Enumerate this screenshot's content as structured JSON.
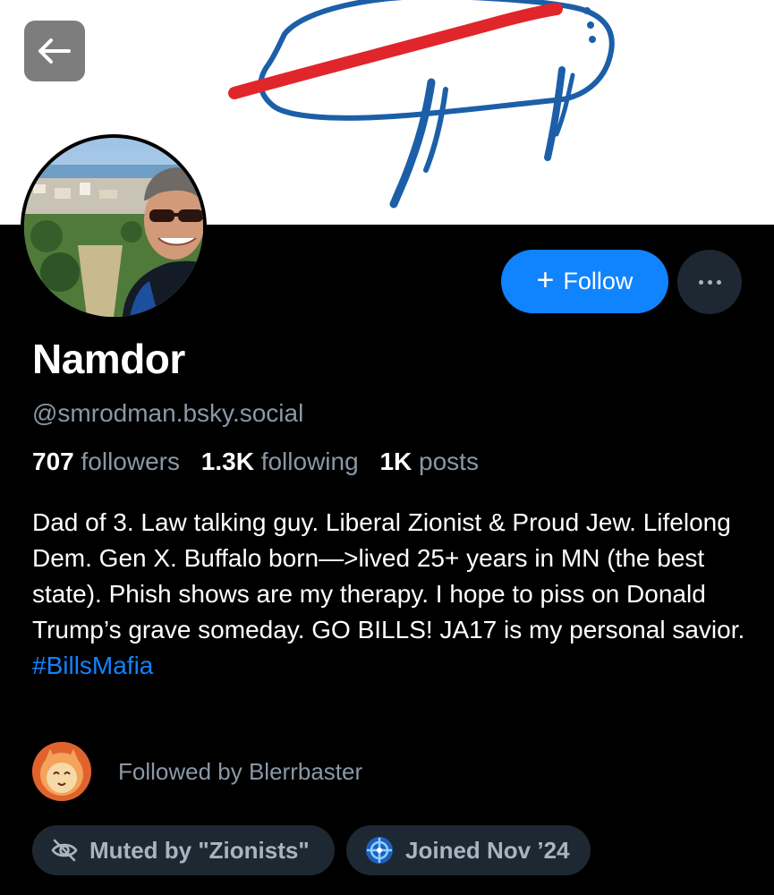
{
  "colors": {
    "background": "#000000",
    "accent": "#1083fe",
    "muted_text": "#8b98a5",
    "pill_background": "#1e2832",
    "banner_background": "#ffffff",
    "banner_red": "#e0262a",
    "banner_blue": "#1c5fa8"
  },
  "header": {
    "back_icon": "arrow-left-icon",
    "banner_image": "hand-drawn-buffalo-banner"
  },
  "actions": {
    "follow_label": "Follow",
    "follow_icon": "plus-icon",
    "more_icon": "ellipsis-icon"
  },
  "profile": {
    "display_name": "Namdor",
    "handle": "@smrodman.bsky.social",
    "stats": {
      "followers_count": "707",
      "followers_label": "followers",
      "following_count": "1.3K",
      "following_label": "following",
      "posts_count": "1K",
      "posts_label": "posts"
    },
    "bio": "Dad of 3. Law talking guy. Liberal Zionist & Proud Jew. Lifelong Dem. Gen X. Buffalo born—>lived 25+ years in MN (the best state). Phish shows are my therapy. I hope to piss on Donald Trump’s grave someday. GO BILLS! JA17 is my personal savior.",
    "hashtag": "#BillsMafia",
    "followed_by": "Followed by Blerrbaster"
  },
  "badges": {
    "muted_label": "Muted by \"Zionists\"",
    "muted_icon": "eye-slash-icon",
    "joined_label": "Joined Nov ’24",
    "joined_icon": "new-user-icon"
  }
}
